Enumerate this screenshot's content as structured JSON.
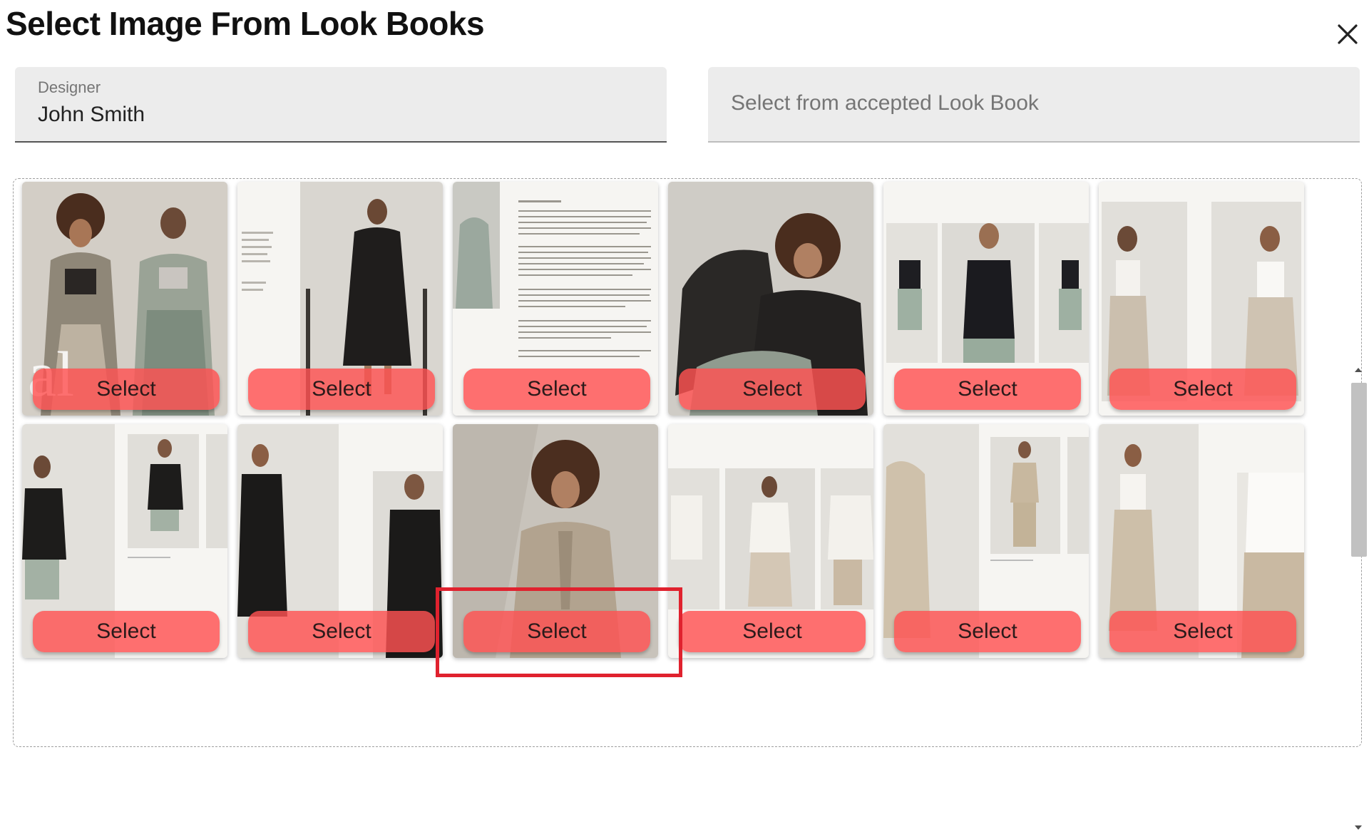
{
  "dialog": {
    "title": "Select Image From Look Books",
    "close_icon": "close-icon"
  },
  "designer_field": {
    "label": "Designer",
    "value": "John Smith"
  },
  "lookbook_field": {
    "placeholder": "Select from accepted Look Book"
  },
  "gallery": {
    "select_label": "Select",
    "highlighted_tile": 9,
    "tiles": [
      {
        "icon": "two-models-photo-icon"
      },
      {
        "icon": "model-black-dress-photo-icon"
      },
      {
        "icon": "text-page-photo-icon"
      },
      {
        "icon": "model-seated-photo-icon"
      },
      {
        "icon": "model-black-top-photo-icon"
      },
      {
        "icon": "model-white-top-photo-icon"
      },
      {
        "icon": "model-black-shirt-photo-icon"
      },
      {
        "icon": "model-black-dress-photo-icon"
      },
      {
        "icon": "model-beige-coat-photo-icon"
      },
      {
        "icon": "model-white-shirt-photo-icon"
      },
      {
        "icon": "model-beige-suit-photo-icon"
      },
      {
        "icon": "model-beige-trousers-photo-icon"
      }
    ]
  },
  "colors": {
    "select_button": "#ff5252",
    "highlight": "#e0222e"
  }
}
